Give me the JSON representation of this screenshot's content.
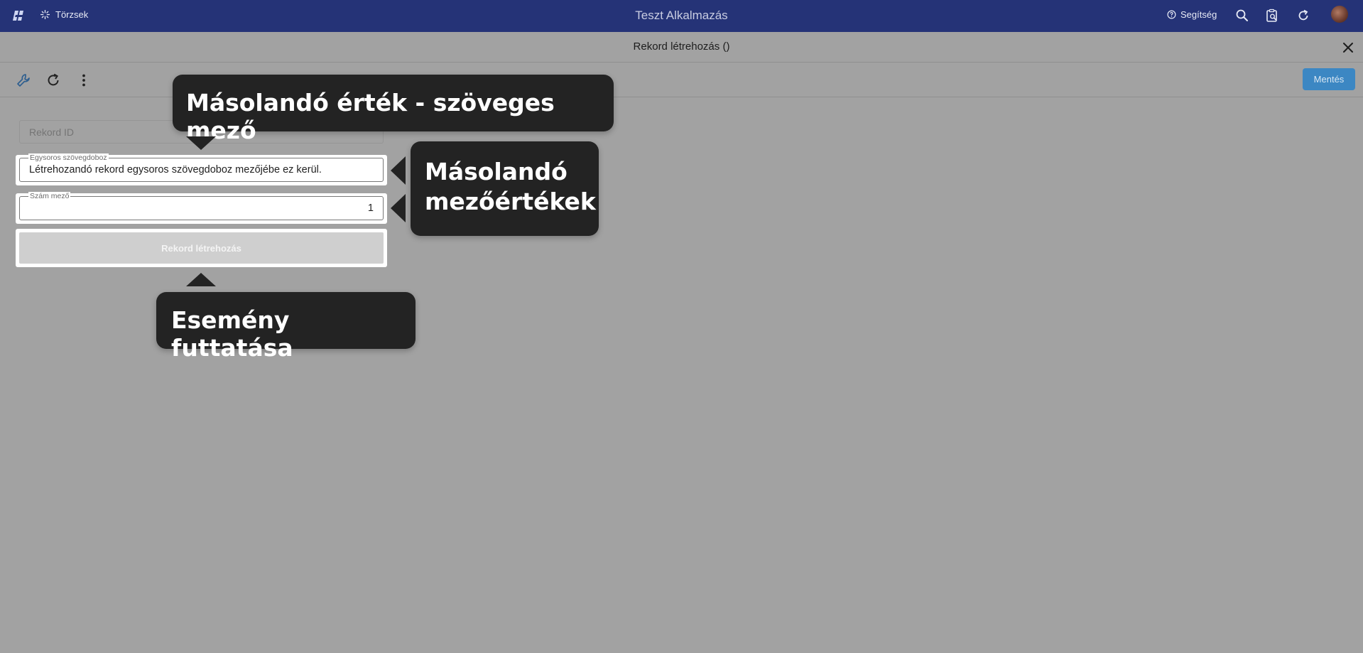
{
  "header": {
    "app_title": "Teszt Alkalmazás",
    "nav_label": "Törzsek",
    "help_label": "Segítség"
  },
  "subheader": {
    "title": "Rekord létrehozás ()"
  },
  "toolbar": {
    "save_label": "Mentés"
  },
  "form": {
    "record_id_placeholder": "Rekord ID",
    "text_field": {
      "label": "Egysoros szövegdoboz",
      "value": "Létrehozandó rekord egysoros szövegdoboz mezőjébe ez kerül."
    },
    "number_field": {
      "label": "Szám mező",
      "value": "1"
    },
    "create_button_label": "Rekord létrehozás"
  },
  "callouts": {
    "top": "Másolandó érték - szöveges mező",
    "right_line1": "Másolandó",
    "right_line2": "mezőértékek",
    "bottom": "Esemény futtatása"
  },
  "colors": {
    "topbar": "#253377",
    "background": "#a2a2a2",
    "save_button": "#3c87c3",
    "callout": "#232323"
  }
}
